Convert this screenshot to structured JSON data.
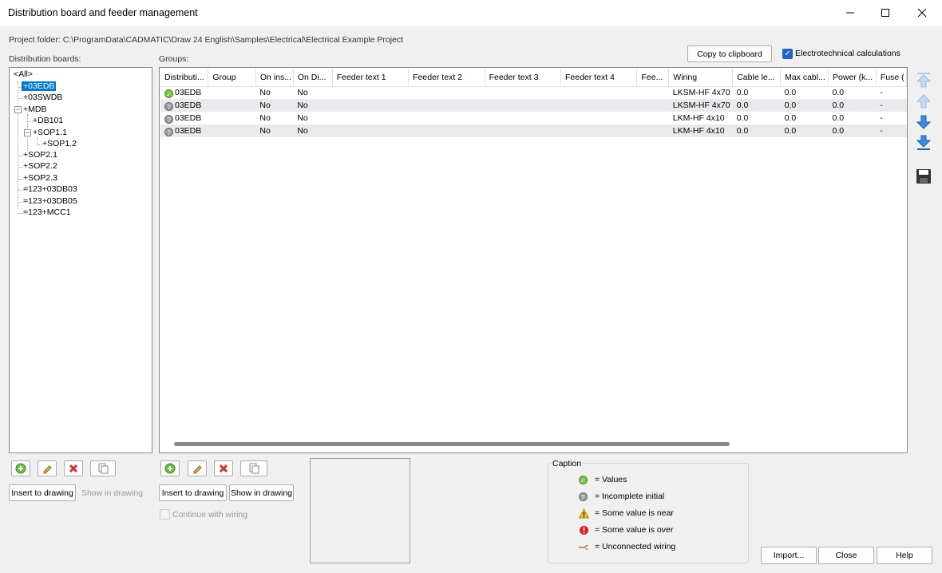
{
  "window": {
    "title": "Distribution board and feeder management"
  },
  "project_folder": "Project folder: C:\\ProgramData\\CADMATIC\\Draw 24 English\\Samples\\Electrical\\Electrical Example Project",
  "labels": {
    "distribution_boards": "Distribution boards:",
    "groups": "Groups:"
  },
  "toolbar": {
    "copy_to_clipboard": "Copy to clipboard",
    "electrotechnical_calculations": "Electrotechnical calculations"
  },
  "tree": {
    "all": "<All>",
    "nodes": [
      "+03EDB",
      "+03SWDB",
      "+MDB",
      "+DB101",
      "+SOP1.1",
      "+SOP1.2",
      "+SOP2.1",
      "+SOP2.2",
      "+SOP2.3",
      "=123+03DB03",
      "=123+03DB05",
      "=123+MCC1"
    ]
  },
  "grid": {
    "columns": [
      "Distributi...",
      "Group",
      "On ins...",
      "On Di...",
      "Feeder text 1",
      "Feeder text 2",
      "Feeder text 3",
      "Feeder text 4",
      "Fee...",
      "Wiring",
      "Cable le...",
      "Max cabl...",
      "Power (k...",
      "Fuse ("
    ],
    "rows": [
      {
        "status": "values",
        "dist": "03EDB",
        "group": "",
        "on_ins": "No",
        "on_di": "No",
        "wiring": "LKSM-HF 4x70",
        "cable_len": "0.0",
        "max_cable": "0.0",
        "power": "0.0",
        "fuse": "-"
      },
      {
        "status": "incomplete",
        "dist": "03EDB",
        "group": "",
        "on_ins": "No",
        "on_di": "No",
        "wiring": "LKSM-HF 4x70",
        "cable_len": "0.0",
        "max_cable": "0.0",
        "power": "0.0",
        "fuse": "-"
      },
      {
        "status": "incomplete",
        "dist": "03EDB",
        "group": "",
        "on_ins": "No",
        "on_di": "No",
        "wiring": "LKM-HF 4x10",
        "cable_len": "0.0",
        "max_cable": "0.0",
        "power": "0.0",
        "fuse": "-"
      },
      {
        "status": "incomplete",
        "dist": "03EDB",
        "group": "",
        "on_ins": "No",
        "on_di": "No",
        "wiring": "LKM-HF 4x10",
        "cable_len": "0.0",
        "max_cable": "0.0",
        "power": "0.0",
        "fuse": "-"
      }
    ]
  },
  "left_buttons": {
    "insert_to_drawing": "Insert to drawing",
    "show_in_drawing": "Show in drawing"
  },
  "group_buttons": {
    "insert_to_drawing": "Insert to drawing",
    "show_in_drawing": "Show in drawing",
    "continue_with_wiring": "Continue with wiring"
  },
  "caption": {
    "title": "Caption",
    "items": [
      "= Values",
      "= Incomplete initial",
      "= Some value is near",
      "= Some value is over",
      "= Unconnected wiring"
    ]
  },
  "footer": {
    "import": "Import...",
    "close": "Close",
    "help": "Help"
  },
  "colors": {
    "accent": "#0078d7",
    "ok": "#7cc243",
    "incomplete": "#9a9a9a",
    "warning": "#f0c020",
    "error": "#e02020"
  },
  "icons": [
    "add-icon",
    "edit-icon",
    "delete-icon",
    "copy-icon",
    "move-top-icon",
    "move-up-icon",
    "move-down-icon",
    "move-bottom-icon",
    "save-icon"
  ]
}
